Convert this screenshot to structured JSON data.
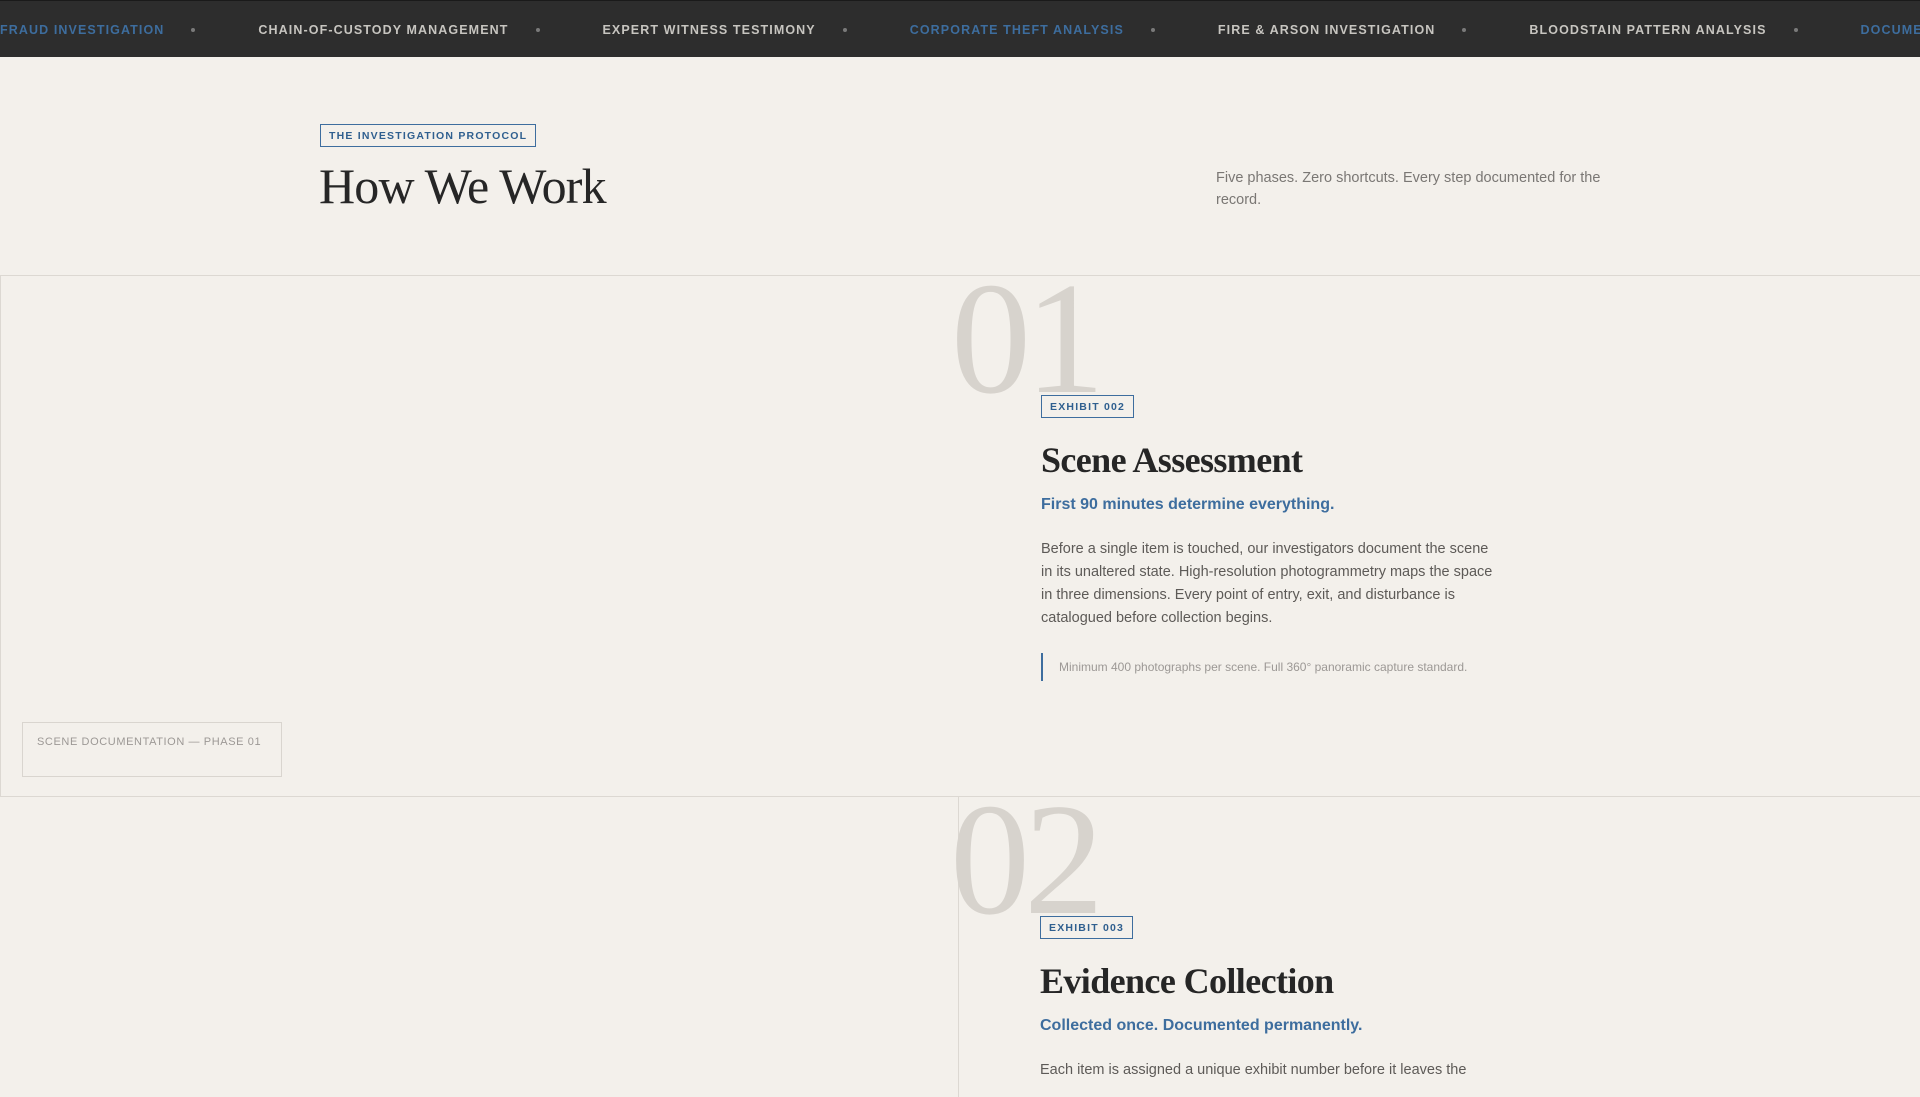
{
  "ticker": {
    "items": [
      {
        "label": "Fraud Investigation",
        "accent": true
      },
      {
        "label": "Chain-of-Custody Management",
        "accent": false
      },
      {
        "label": "Expert Witness Testimony",
        "accent": false
      },
      {
        "label": "Corporate Theft Analysis",
        "accent": true
      },
      {
        "label": "Fire & Arson Investigation",
        "accent": false
      },
      {
        "label": "Bloodstain Pattern Analysis",
        "accent": false
      },
      {
        "label": "Document Examination",
        "accent": true
      }
    ]
  },
  "header": {
    "tag": "The Investigation Protocol",
    "title": "How We Work",
    "subtitle": "Five phases. Zero shortcuts. Every step documented for the record."
  },
  "phases": [
    {
      "number": "01",
      "exhibit": "Exhibit 002",
      "title": "Scene Assessment",
      "lead": "First 90 minutes determine everything.",
      "body": "Before a single item is touched, our investigators document the scene in its unaltered state. High-resolution photogrammetry maps the space in three dimensions. Every point of entry, exit, and disturbance is catalogued before collection begins.",
      "note": "Minimum 400 photographs per scene. Full 360° panoramic capture standard.",
      "photo_caption": "Scene Documentation — Phase 01"
    },
    {
      "number": "02",
      "exhibit": "Exhibit 003",
      "title": "Evidence Collection",
      "lead": "Collected once. Documented permanently.",
      "body": "Each item is assigned a unique exhibit number before it leaves the"
    }
  ],
  "colors": {
    "background": "#f3f0eb",
    "ticker_bg": "#2d2d2d",
    "accent": "#3d6d9e",
    "phase_number": "#d7d3cd"
  }
}
